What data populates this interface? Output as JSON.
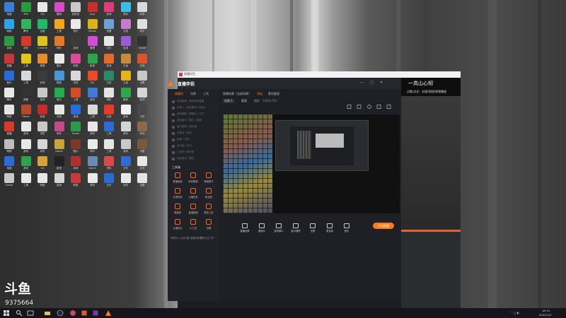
{
  "desktop": {
    "icons": [
      {
        "label": "电脑",
        "color": "#3b7fd6"
      },
      {
        "label": "360",
        "color": "#2b9a3a"
      },
      {
        "label": "QQ",
        "color": "#e8e8e8"
      },
      {
        "label": "酷狗",
        "color": "#d64bc6"
      },
      {
        "label": "回收站",
        "color": "#c9c9c9"
      },
      {
        "label": "App",
        "color": "#c9302c"
      },
      {
        "label": "游戏",
        "color": "#e23a7a"
      },
      {
        "label": "资料",
        "color": "#3fbce6"
      },
      {
        "label": "网易",
        "color": "#d9d9d9"
      },
      {
        "label": "网络",
        "color": "#2fa3e8"
      },
      {
        "label": "腾讯",
        "color": "#33b35a"
      },
      {
        "label": "百度",
        "color": "#1fbb6a"
      },
      {
        "label": "工具",
        "color": "#f2a51e"
      },
      {
        "label": "音乐",
        "color": "#eaeaea"
      },
      {
        "label": "Steam",
        "color": "#dcb11a"
      },
      {
        "label": "设置",
        "color": "#6fa0d8"
      },
      {
        "label": "文档",
        "color": "#c87acb"
      },
      {
        "label": "网页",
        "color": "#e0e0e0"
      },
      {
        "label": "控制",
        "color": "#2e9a43"
      },
      {
        "label": "浏览",
        "color": "#d43a2a"
      },
      {
        "label": "Chrome",
        "color": "#dcc21e"
      },
      {
        "label": "软件",
        "color": "#e37a2a"
      },
      {
        "label": "游戏",
        "color": "#3a3a3a"
      },
      {
        "label": "管理",
        "color": "#d44bd6"
      },
      {
        "label": "文件",
        "color": "#e7e7e7"
      },
      {
        "label": "应用",
        "color": "#9c5bd4"
      },
      {
        "label": "Game",
        "color": "#333333"
      },
      {
        "label": "直播",
        "color": "#c33a3a"
      },
      {
        "label": "工具",
        "color": "#e3c51e"
      },
      {
        "label": "视频",
        "color": "#ea8a2a"
      },
      {
        "label": "图片",
        "color": "#e9e9e9"
      },
      {
        "label": "网易",
        "color": "#d84a9a"
      },
      {
        "label": "影音",
        "color": "#2fa34a"
      },
      {
        "label": "游戏",
        "color": "#e26a2a"
      },
      {
        "label": "王者",
        "color": "#c88a3a"
      },
      {
        "label": "加速",
        "color": "#d8542a"
      },
      {
        "label": "音乐",
        "color": "#2b6bd6"
      },
      {
        "label": "工具",
        "color": "#d8d8d8"
      },
      {
        "label": "游戏",
        "color": "#3b3b3b"
      },
      {
        "label": "微信",
        "color": "#4c94d8"
      },
      {
        "label": "浏览",
        "color": "#d8d8d8"
      },
      {
        "label": "QQ",
        "color": "#e84a2a"
      },
      {
        "label": "日历",
        "color": "#2b8a6a"
      },
      {
        "label": "王者",
        "color": "#e6b21a"
      },
      {
        "label": "设置",
        "color": "#c8c8c8"
      },
      {
        "label": "腾讯",
        "color": "#e7e7e7"
      },
      {
        "label": "视频",
        "color": "#333333"
      },
      {
        "label": "游戏",
        "color": "#c8c8c8"
      },
      {
        "label": "音乐",
        "color": "#23b04a"
      },
      {
        "label": "工具",
        "color": "#d64a2a"
      },
      {
        "label": "游戏",
        "color": "#3f7bd6"
      },
      {
        "label": "资料",
        "color": "#e3e3e3"
      },
      {
        "label": "管家",
        "color": "#2fa64a"
      },
      {
        "label": "影视",
        "color": "#d6d6d6"
      },
      {
        "label": "网络",
        "color": "#e5e5e5"
      },
      {
        "label": "Game",
        "color": "#b44a2a"
      },
      {
        "label": "游戏",
        "color": "#c62a2a"
      },
      {
        "label": "浏览",
        "color": "#e7e7e7"
      },
      {
        "label": "游戏",
        "color": "#2b6bd6"
      },
      {
        "label": "工具",
        "color": "#d8d8d8"
      },
      {
        "label": "应用",
        "color": "#e73a2a"
      },
      {
        "label": "游戏",
        "color": "#f1f1f1"
      },
      {
        "label": "日历",
        "color": "#4a4a4a"
      },
      {
        "label": "直播",
        "color": "#d63a2a"
      },
      {
        "label": "游戏",
        "color": "#e7e7e7"
      },
      {
        "label": "浏览",
        "color": "#c8c8c8"
      },
      {
        "label": "软件",
        "color": "#c44a8a"
      },
      {
        "label": "Game",
        "color": "#2b9a4a"
      },
      {
        "label": "游戏",
        "color": "#e6e6e6"
      },
      {
        "label": "工具",
        "color": "#2f6bd6"
      },
      {
        "label": "资料",
        "color": "#d5d5d5"
      },
      {
        "label": "网站",
        "color": "#8a6a4a"
      },
      {
        "label": "网络",
        "color": "#bdbdbd"
      },
      {
        "label": "游戏",
        "color": "#e8e8e8"
      },
      {
        "label": "浏览",
        "color": "#d6d6d6"
      },
      {
        "label": "Game",
        "color": "#c8a23a"
      },
      {
        "label": "图片",
        "color": "#7a3a2a"
      },
      {
        "label": "资料",
        "color": "#eaeaea"
      },
      {
        "label": "工具",
        "color": "#e5e5e5"
      },
      {
        "label": "游戏",
        "color": "#c9c9c9"
      },
      {
        "label": "设置",
        "color": "#7a5a3a"
      },
      {
        "label": "电脑",
        "color": "#2b6bd6"
      },
      {
        "label": "游戏",
        "color": "#2fa34a"
      },
      {
        "label": "QQ",
        "color": "#d8a23a"
      },
      {
        "label": "影音",
        "color": "#222222"
      },
      {
        "label": "游戏",
        "color": "#b2302a"
      },
      {
        "label": "Game",
        "color": "#6a8ab8"
      },
      {
        "label": "资料",
        "color": "#d84a4a"
      },
      {
        "label": "文件",
        "color": "#2f6bd6"
      },
      {
        "label": "应用",
        "color": "#e8e8e8"
      },
      {
        "label": "Game",
        "color": "#c8c8c8"
      },
      {
        "label": "工具",
        "color": "#e7e7e7"
      },
      {
        "label": "网络",
        "color": "#e7e7e7"
      },
      {
        "label": "游戏",
        "color": "#d6d6d6"
      },
      {
        "label": "网易",
        "color": "#c83a3a"
      },
      {
        "label": "资料",
        "color": "#e9e9e9"
      },
      {
        "label": "文件",
        "color": "#2b6bd6"
      },
      {
        "label": "浏览",
        "color": "#e8e8e8"
      },
      {
        "label": "设置",
        "color": "#e5e5e5"
      }
    ]
  },
  "app": {
    "title_strip": "直播伴侣",
    "brand": "直播伴侣",
    "left_tabs": [
      "直播间",
      "场景",
      "工具"
    ],
    "left_rows": [
      "游戏推荐 / 推荐游戏直播",
      "场景 2 / 添加素材 / 场景3",
      "桌面捕获 / 摄像头 / 文字",
      "游戏窗口 / 图片 / 视频",
      "窗口捕获 / 媒体源",
      "多媒体 / 游戏",
      "投屏 / 手机",
      "画中画 / 文字",
      "小游戏 / 聊天框",
      "背景音乐 / 素材"
    ],
    "tools_header": "工具箱",
    "tools": [
      "直播画面",
      "房间管理",
      "弹幕助手",
      "礼物特效",
      "主播任务",
      "粉丝团",
      "弹幕姬",
      "直播数据",
      "更多工具",
      "主播成长",
      "小工具",
      "设置"
    ],
    "scene_header": [
      "直播场景（全部场景）",
      "添加",
      "素材管理",
      "场景 1",
      "管理",
      "横屏 · 1280x720"
    ],
    "bottom_bar": [
      "直播设置",
      "摄像头",
      "游戏窗口",
      "窗口捕获",
      "全屏",
      "麦克风",
      "音乐"
    ],
    "live_button": "开始直播",
    "bottom_links": [
      "帮助中心",
      "反馈问题",
      "直播间管理",
      "更新日志",
      "关于"
    ],
    "right_panel": {
      "big_text": "一岚山心彻",
      "sub_text": "点歌/点名：封面/视频/视频播放"
    },
    "window_controls": [
      "—",
      "□",
      "✕"
    ]
  },
  "overlay": {
    "big": "斗鱼",
    "number": "9375664"
  },
  "taskbar": {
    "clock_time": "18:14",
    "clock_date": "2022/1/4"
  },
  "colors": {
    "accent": "#ff7a1a",
    "taskbar": "#16161a"
  }
}
